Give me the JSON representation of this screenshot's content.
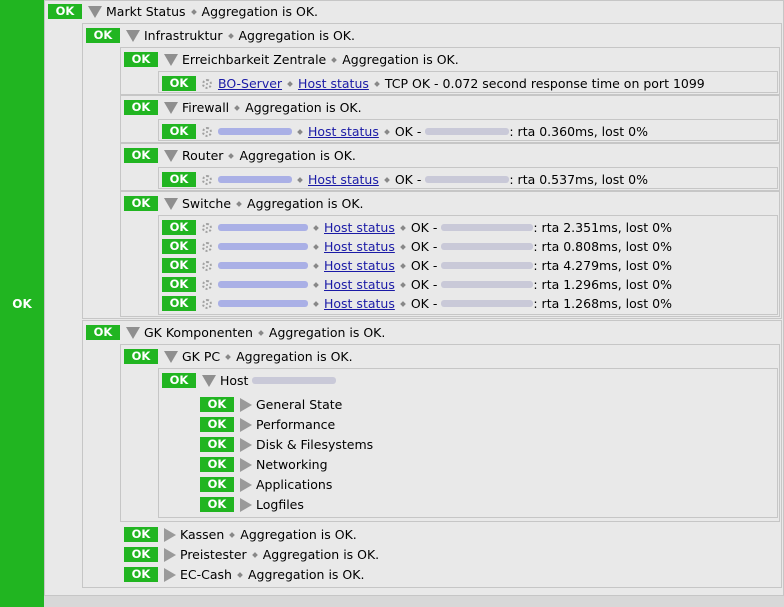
{
  "sidebar": {
    "status": "OK"
  },
  "labels": {
    "ok": "OK",
    "aggregation": "Aggregation is OK.",
    "host_status": "Host status"
  },
  "tree": {
    "markt": "Markt Status",
    "infra": "Infrastruktur",
    "erreich": "Erreichbarkeit Zentrale",
    "bo_server": "BO-Server",
    "bo_output": "TCP OK - 0.072 second response time on port 1099",
    "firewall": "Firewall",
    "firewall_out_prefix": "OK -",
    "firewall_rta": ": rta 0.360ms, lost 0%",
    "router": "Router",
    "router_out_prefix": "OK -",
    "router_rta": ": rta 0.537ms, lost 0%",
    "switche": "Switche",
    "switch_rows": [
      {
        "prefix": "OK -",
        "rta": ": rta 2.351ms, lost 0%"
      },
      {
        "prefix": "OK -",
        "rta": ": rta 0.808ms, lost 0%"
      },
      {
        "prefix": "OK -",
        "rta": ": rta 4.279ms, lost 0%"
      },
      {
        "prefix": "OK -",
        "rta": ": rta 1.296ms, lost 0%"
      },
      {
        "prefix": "OK -",
        "rta": ": rta 1.268ms, lost 0%"
      }
    ],
    "gk_komponenten": "GK Komponenten",
    "gk_pc": "GK PC",
    "host_prefix": "Host",
    "host_children": [
      "General State",
      "Performance",
      "Disk & Filesystems",
      "Networking",
      "Applications",
      "Logfiles"
    ],
    "kassen": "Kassen",
    "preistester": "Preistester",
    "ec_cash": "EC-Cash"
  }
}
